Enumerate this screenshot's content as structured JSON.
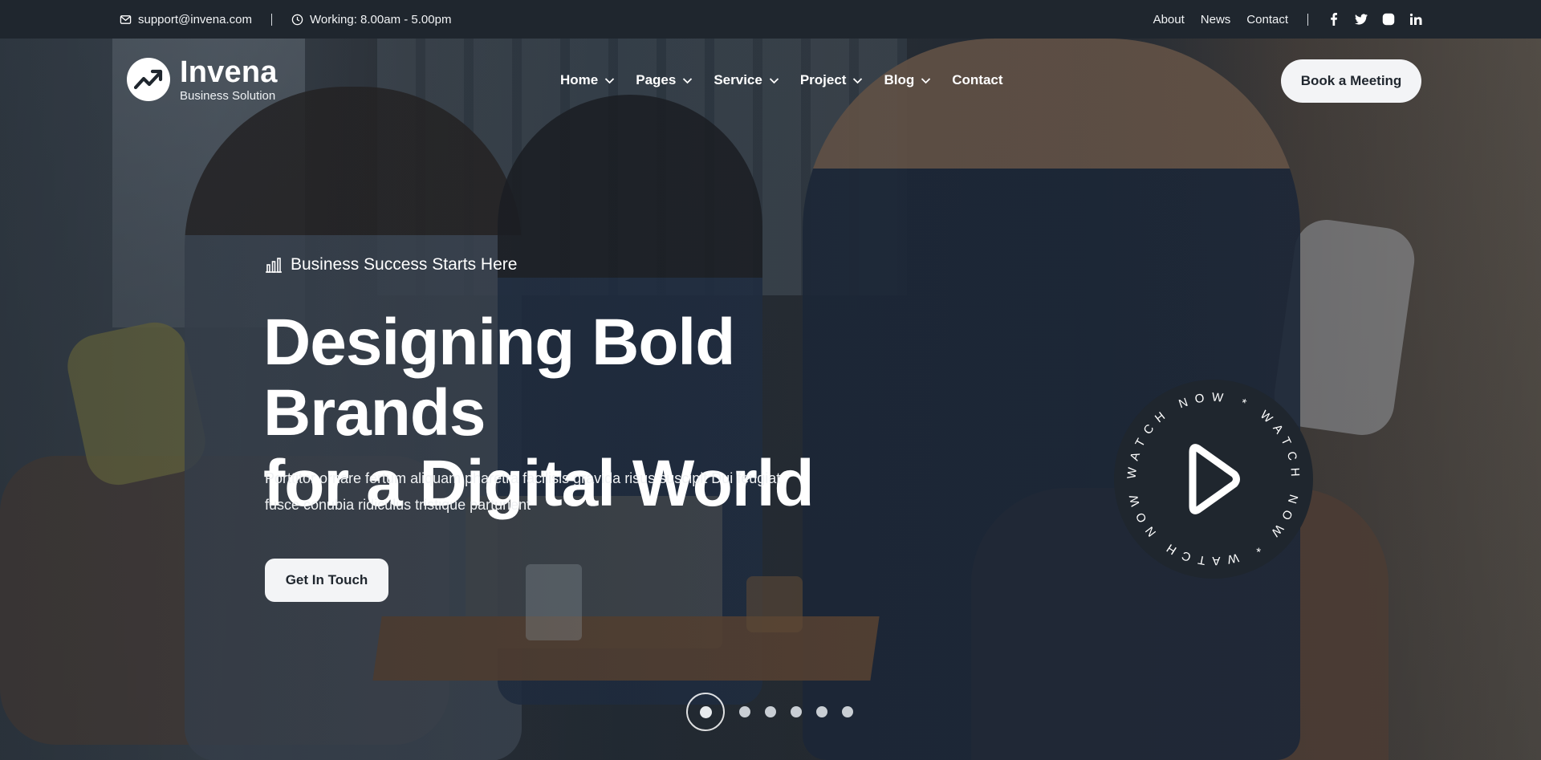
{
  "topbar": {
    "email": "support@invena.com",
    "working_hours": "Working: 8.00am - 5.00pm",
    "links": [
      "About",
      "News",
      "Contact"
    ],
    "socials": [
      "facebook-icon",
      "twitter-icon",
      "instagram-icon",
      "linkedin-icon"
    ]
  },
  "brand": {
    "name": "Invena",
    "tagline": "Business Solution"
  },
  "nav": {
    "items": [
      {
        "label": "Home",
        "dropdown": true
      },
      {
        "label": "Pages",
        "dropdown": true
      },
      {
        "label": "Service",
        "dropdown": true
      },
      {
        "label": "Project",
        "dropdown": true
      },
      {
        "label": "Blog",
        "dropdown": true
      },
      {
        "label": "Contact",
        "dropdown": false
      }
    ],
    "cta": "Book a Meeting"
  },
  "hero": {
    "eyebrow": "Business Success Starts Here",
    "title_line1": "Designing Bold Brands",
    "title_line2": "for a Digital World",
    "subtitle_line1": "Porttitor ornare fertum aliquam pharetra facilisis gravida risus suscipit Dui feugiat",
    "subtitle_line2": "fusce conubia ridiculus tristique parturient",
    "cta": "Get In Touch",
    "watch_text": "WATCH NOW * WATCH NOW * WATCH NOW * "
  },
  "slider": {
    "total": 6,
    "active": 1
  },
  "colors": {
    "topbar_bg": "#1f262e",
    "button_bg": "#f3f4f6",
    "button_text": "#1f262e",
    "text": "#ffffff"
  }
}
